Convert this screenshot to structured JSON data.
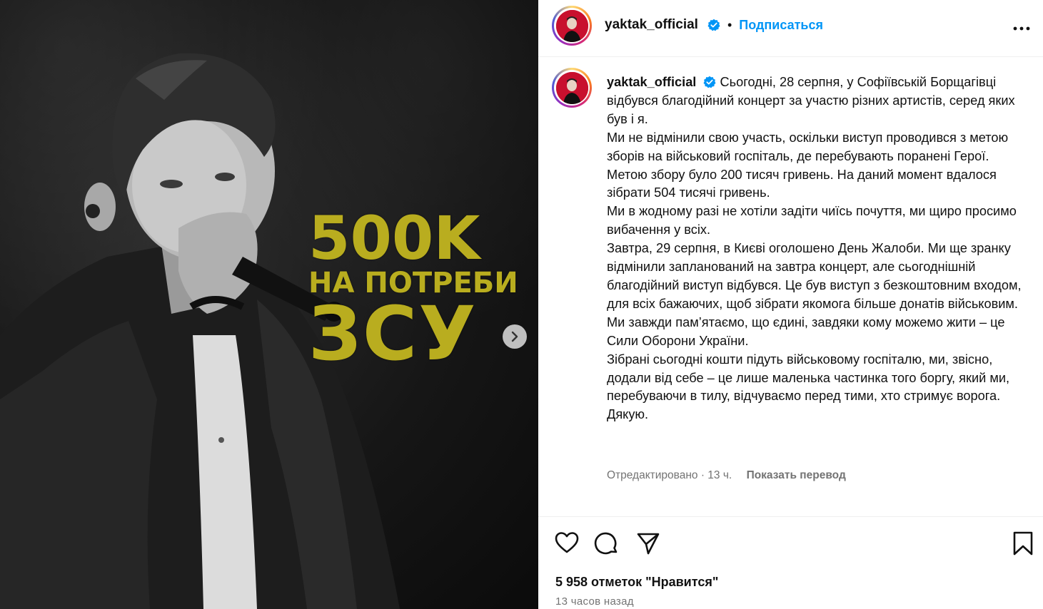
{
  "media": {
    "overlay_line1": "500K",
    "overlay_line2": "НА ПОТРЕБИ",
    "overlay_line3": "ЗСУ",
    "next_icon": "chevron-right-icon"
  },
  "header": {
    "username": "yaktak_official",
    "separator": "•",
    "subscribe_label": "Подписаться",
    "more_icon": "more-horizontal-icon"
  },
  "caption": {
    "username": "yaktak_official",
    "lines": [
      "Сьогодні, 28 серпня, у Софіївській Борщагівці відбувся благодійний концерт за участю різних артистів, серед яких був і я.",
      "Ми не відмінили свою участь, оскільки виступ проводився з метою зборів на військовий госпіталь, де перебувають поранені Герої. Метою збору було 200 тисяч гривень. На даний момент вдалося зібрати 504 тисячі гривень.",
      "Ми в жодному разі не хотіли задіти чиїсь почуття, ми щиро просимо вибачення у всіх.",
      "Завтра, 29 серпня, в Києві оголошено День Жалоби. Ми ще зранку відмінили запланований на завтра концерт, але сьогоднішній благодійний виступ відбувся. Це був виступ з безкоштовним входом, для всіх бажаючих, щоб зібрати якомога більше донатів військовим.",
      "Ми завжди пам’ятаємо, що єдині, завдяки кому можемо жити – це Сили Оборони України.",
      "Зібрані сьогодні кошти підуть військовому госпіталю, ми, звісно, додали від себе – це лише маленька частинка того боргу, який ми, перебуваючи в тилу, відчуваємо перед тими, хто стримує ворога.",
      "Дякую."
    ],
    "meta_edited": "Отредактировано · 13 ч.",
    "translate_label": "Показать перевод"
  },
  "actions": {
    "like_icon": "heart-icon",
    "comment_icon": "comment-icon",
    "share_icon": "share-icon",
    "save_icon": "bookmark-icon"
  },
  "likes_text": "5 958 отметок \"Нравится\"",
  "time_text": "13 часов назад",
  "colors": {
    "accent": "#0095f6",
    "overlay_yellow": "#b9ad1f",
    "verified": "#0095f6",
    "meta_gray": "#737373"
  }
}
